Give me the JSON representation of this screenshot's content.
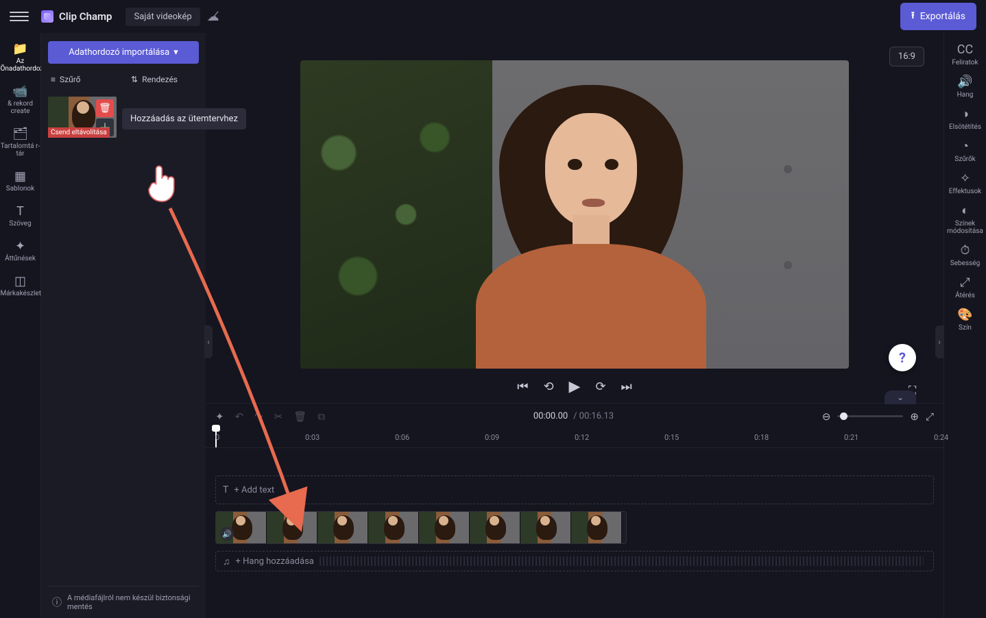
{
  "header": {
    "app_name": "Clip Champ",
    "project_name": "Saját videokép",
    "export_label": "Exportálás"
  },
  "left_rail": [
    {
      "icon": "📁",
      "label": "Az Önadathordozója",
      "active": true
    },
    {
      "icon": "📹",
      "label": "&amp; rekord create"
    },
    {
      "icon": "🗂",
      "label": "Tartalomtá r-tár"
    },
    {
      "icon": "▦",
      "label": "Sablonok"
    },
    {
      "icon": "T",
      "label": "Szöveg"
    },
    {
      "icon": "✦",
      "label": "Áttűnések"
    },
    {
      "icon": "◫",
      "label": "Márkakészlet"
    }
  ],
  "media_panel": {
    "import_label": "Adathordozó importálása",
    "filter_label": "Szűrő",
    "sort_label": "Rendezés",
    "thumb_caption": "Csend eltávolítása",
    "tooltip": "Hozzáadás az ütemtervhez",
    "backup_text": "A médiafájlról nem készül biztonsági mentés"
  },
  "preview": {
    "aspect_label": "16:9"
  },
  "timeline": {
    "current": "00:00.00",
    "duration": "00:16.13",
    "ruler_ticks": [
      "0",
      "0:03",
      "0:06",
      "0:09",
      "0:12",
      "0:15",
      "0:18",
      "0:21",
      "0:24"
    ],
    "text_track_placeholder": "+ Add text",
    "audio_track_placeholder": "+ Hang hozzáadása"
  },
  "right_rail": [
    {
      "icon": "CC",
      "label": "Feliratok"
    },
    {
      "icon": "🔊",
      "label": "Hang"
    },
    {
      "icon": "◑",
      "label": "Elsötétítés"
    },
    {
      "icon": "◔",
      "label": "Szűrők"
    },
    {
      "icon": "✧",
      "label": "Effektusok"
    },
    {
      "icon": "◐",
      "label": "Színek módosítása"
    },
    {
      "icon": "⏱",
      "label": "Sebesség"
    },
    {
      "icon": "⤢",
      "label": "Átérés"
    },
    {
      "icon": "🎨",
      "label": "Szín"
    }
  ]
}
